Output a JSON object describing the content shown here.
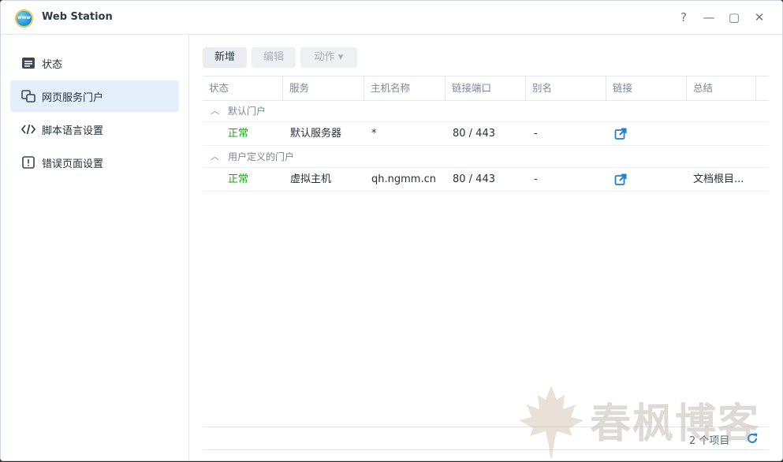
{
  "window": {
    "title": "Web Station",
    "app_icon_text": "www",
    "controls": [
      "?",
      "—",
      "▢",
      "✕"
    ]
  },
  "sidebar": {
    "items": [
      {
        "label": "状态",
        "icon": "list-icon"
      },
      {
        "label": "网页服务门户",
        "icon": "portal-icon",
        "active": true
      },
      {
        "label": "脚本语言设置",
        "icon": "code-icon"
      },
      {
        "label": "错误页面设置",
        "icon": "error-icon"
      }
    ]
  },
  "toolbar": {
    "create": "新增",
    "edit": "编辑",
    "action": "动作 ▾"
  },
  "table": {
    "columns": [
      "状态",
      "服务",
      "主机名称",
      "链接端口",
      "别名",
      "链接",
      "总结"
    ],
    "groups": [
      {
        "label": "默认门户",
        "rows": [
          {
            "status": "正常",
            "service": "默认服务器",
            "host": "*",
            "port": "80 / 443",
            "alias": "-",
            "link": "external-link-icon",
            "summary": ""
          }
        ]
      },
      {
        "label": "用户定义的门户",
        "rows": [
          {
            "status": "正常",
            "service": "虚拟主机",
            "host": "qh.ngmm.cn",
            "port": "80 / 443",
            "alias": "-",
            "link": "external-link-icon",
            "summary": "文档根目..."
          }
        ]
      }
    ],
    "item_count": "2 个项目"
  },
  "watermark": {
    "text": "春枫博客"
  },
  "colors": {
    "accent": "#1f7fd6",
    "ok": "#1ba31b",
    "active_bg": "#e4effb"
  }
}
